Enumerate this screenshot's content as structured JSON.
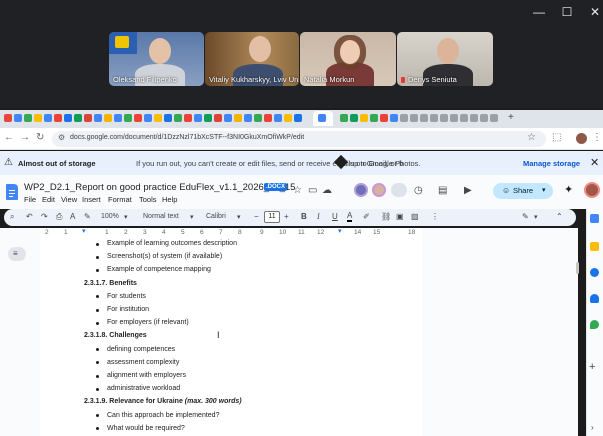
{
  "meeting": {
    "participants": [
      {
        "name": "Oleksand Filipenko"
      },
      {
        "name": "Vitaliy Kukharskyy, Lviv Uni..."
      },
      {
        "name": "Natalia Morkun"
      },
      {
        "name": "Denys Seniuta"
      }
    ],
    "window_controls": {
      "minimize": "—",
      "maximize": "☐",
      "close": "✕"
    }
  },
  "browser": {
    "url": "docs.google.com/document/d/1DzzNzl71bXcSTF--f3NI0GkuXmOfiWkP/edit",
    "nav": {
      "back": "←",
      "forward": "→",
      "reload": "↻",
      "site_info": "⚙"
    }
  },
  "banner": {
    "title": "Almost out of storage",
    "text": "If you run out, you can't create or edit files, send or receive emails on Gmail, or b",
    "text_tail": "up to Google Photos.",
    "action": "Manage storage",
    "close": "✕"
  },
  "docs": {
    "title": "WP2_D2.1_Report on good practice EduFlex_v1.1_2026_04_15",
    "badge": ".DOCX",
    "menu": [
      "File",
      "Edit",
      "View",
      "Insert",
      "Format",
      "Tools",
      "Help"
    ],
    "share": "Share"
  },
  "toolbar": {
    "zoom": "100%",
    "style": "Normal text",
    "font": "Calibri",
    "font_size": "11"
  },
  "ruler": [
    "2",
    "1",
    "1",
    "2",
    "3",
    "4",
    "5",
    "6",
    "7",
    "8",
    "9",
    "10",
    "11",
    "12",
    "13",
    "14",
    "15",
    "16",
    "18"
  ],
  "document": {
    "lines": [
      {
        "type": "bullet",
        "text": "Example of learning outcomes description"
      },
      {
        "type": "bullet",
        "text": "Screenshot(s) of system (if available)"
      },
      {
        "type": "bullet",
        "text": "Example of competence mapping"
      },
      {
        "type": "heading",
        "text": "2.3.1.7. Benefits"
      },
      {
        "type": "bullet",
        "text": "For students"
      },
      {
        "type": "bullet",
        "text": "For institution"
      },
      {
        "type": "bullet",
        "text": "For employers (if relevant)"
      },
      {
        "type": "heading",
        "text": "2.3.1.8. Challenges"
      },
      {
        "type": "bullet",
        "text": "defining competences"
      },
      {
        "type": "bullet",
        "text": "assessment complexity"
      },
      {
        "type": "bullet",
        "text": "alignment with employers"
      },
      {
        "type": "bullet",
        "text": "administrative workload"
      },
      {
        "type": "heading",
        "text": "2.3.1.9. Relevance for Ukraine ",
        "emphasis": "(max. 300 words)"
      },
      {
        "type": "bullet",
        "text": "Can this approach be implemented?"
      },
      {
        "type": "bullet",
        "text": "What would be required?"
      }
    ]
  },
  "colors": {
    "accent": "#0b57d0",
    "share_bg": "#c2e7ff",
    "banner_bg": "#e8f0fe",
    "active_speaker": "#2fbf71"
  }
}
